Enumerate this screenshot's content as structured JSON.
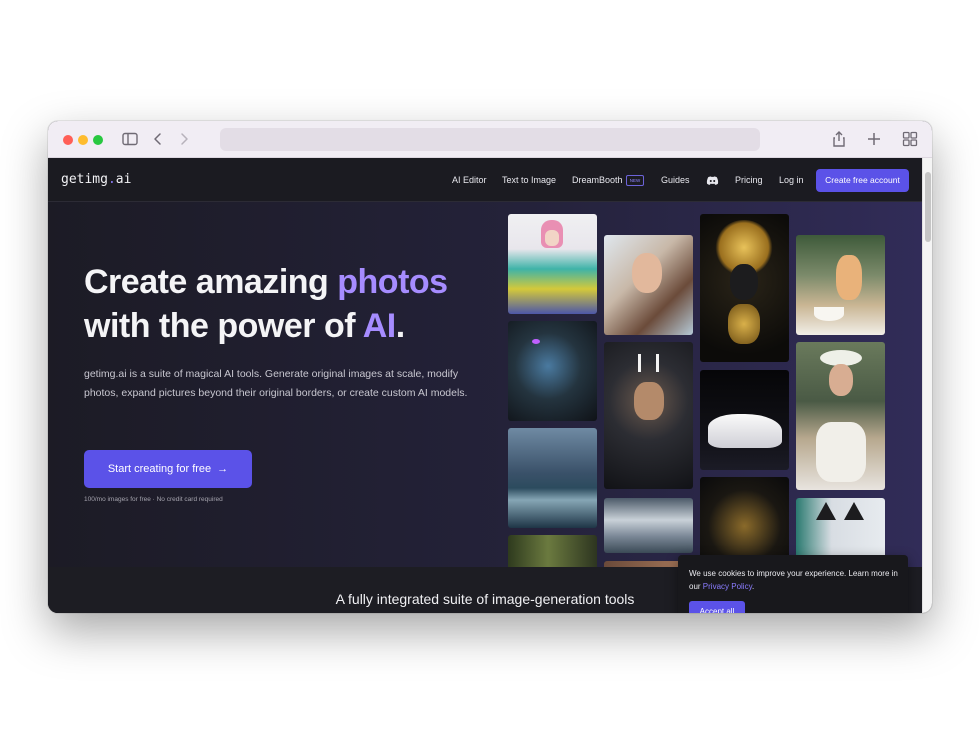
{
  "browser": {
    "icons": [
      "sidebar-icon",
      "back-icon",
      "forward-icon",
      "share-icon",
      "new-tab-icon",
      "tab-overview-icon"
    ]
  },
  "nav": {
    "logo_prefix": "getimg",
    "logo_dot": ".",
    "logo_suffix": "ai",
    "items": [
      "AI Editor",
      "Text to Image",
      "DreamBooth",
      "Guides",
      "Pricing",
      "Log in"
    ],
    "new_badge": "NEW",
    "discord_icon": "discord-icon",
    "cta": "Create free account"
  },
  "hero": {
    "title_part1": "Create amazing ",
    "title_accent1": "photos",
    "title_part2": "with the power of ",
    "title_accent2": "AI",
    "title_period": ".",
    "description": "getimg.ai is a suite of magical AI tools. Generate original images at scale, modify photos, expand pictures beyond their original borders, or create custom AI models.",
    "button": "Start creating for free",
    "button_icon": "arrow-right-icon",
    "note": "100/mo images for free · No credit card required"
  },
  "gallery": {
    "images": [
      "pink-hair-girl-jacket",
      "cyborg-woman",
      "stormy-sea-wave",
      "forest-light",
      "portrait-woman",
      "armored-warrior",
      "clouds-landscape",
      "golden-mask",
      "white-sneaker",
      "golden-ornament",
      "cat-teacup",
      "flower-crown-woman",
      "cat-ears"
    ]
  },
  "section": {
    "title": "A fully integrated suite of image-generation tools"
  },
  "cookie": {
    "text_before": "We use cookies to improve your experience. Learn more in our ",
    "link": "Privacy Policy",
    "text_after": ".",
    "button": "Accept all"
  },
  "colors": {
    "accent": "#5b52e8",
    "accent_text": "#a68cff",
    "background": "#1c1b25"
  }
}
